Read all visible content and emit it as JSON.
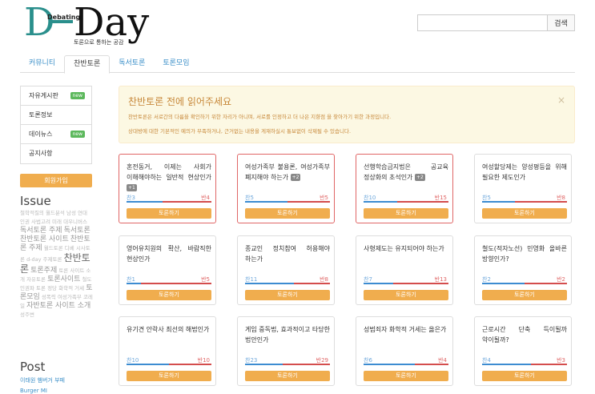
{
  "logo": {
    "big_d": "D",
    "word": "Day",
    "small": "Debating",
    "tagline": "토론으로 통하는 공감"
  },
  "search": {
    "value": "",
    "button_label": "검색"
  },
  "tabs": [
    {
      "label": "커뮤니티"
    },
    {
      "label": "찬반토론"
    },
    {
      "label": "독서토론"
    },
    {
      "label": "토론모임"
    }
  ],
  "sidebar": {
    "items": [
      {
        "label": "자유게시판",
        "badge": "new"
      },
      {
        "label": "토론정보",
        "badge": ""
      },
      {
        "label": "데이뉴스",
        "badge": "new"
      },
      {
        "label": "공지사항",
        "badge": ""
      }
    ],
    "join_label": "회원가입",
    "issue_title": "Issue",
    "tags": [
      {
        "text": "철학적질의",
        "size": "s"
      },
      {
        "text": "월드분석",
        "size": "s"
      },
      {
        "text": "남성",
        "size": "s"
      },
      {
        "text": "연대",
        "size": "s"
      },
      {
        "text": "인권",
        "size": "s"
      },
      {
        "text": "사법고려",
        "size": "s"
      },
      {
        "text": "미래",
        "size": "s"
      },
      {
        "text": "대우니버스",
        "size": "s"
      },
      {
        "text": "독서토론 주제",
        "size": "m"
      },
      {
        "text": "독서토론",
        "size": "m"
      },
      {
        "text": "찬반토론 사이트",
        "size": "m"
      },
      {
        "text": "찬반토론 주제",
        "size": "m"
      },
      {
        "text": "월드토론",
        "size": "s"
      },
      {
        "text": "디베",
        "size": "s"
      },
      {
        "text": "시사토론",
        "size": "s"
      },
      {
        "text": "d-day",
        "size": "s"
      },
      {
        "text": "주제토론",
        "size": "s"
      },
      {
        "text": "찬반토론",
        "size": "l"
      },
      {
        "text": "토론주제",
        "size": "m"
      },
      {
        "text": "토론",
        "size": "s"
      },
      {
        "text": "사이트",
        "size": "s"
      },
      {
        "text": "소개",
        "size": "s"
      },
      {
        "text": "자유토론",
        "size": "s"
      },
      {
        "text": "토론사이트",
        "size": "m"
      },
      {
        "text": "철도",
        "size": "s"
      },
      {
        "text": "인권파",
        "size": "s"
      },
      {
        "text": "토론",
        "size": "s"
      },
      {
        "text": "정당",
        "size": "s"
      },
      {
        "text": "화학적",
        "size": "s"
      },
      {
        "text": "거세",
        "size": "s"
      },
      {
        "text": "토론모임",
        "size": "m"
      },
      {
        "text": "성폭력",
        "size": "s"
      },
      {
        "text": "여성가족부",
        "size": "s"
      },
      {
        "text": "코레일",
        "size": "s"
      },
      {
        "text": "자반토론 사이트 소개",
        "size": "m"
      },
      {
        "text": "성주변",
        "size": "s"
      }
    ],
    "post_title": "Post",
    "posts": [
      {
        "text": "이태원 햄버거 부페"
      },
      {
        "text": "Burger MI"
      }
    ]
  },
  "alert": {
    "title": "찬반토론 전에 읽어주세요",
    "line1": "찬반토론은 서로간의 다름을 확인하기 위한 자리가 아니며, 서로를 인정하고 더 나은 지향점 을 찾아가기 위한 과정입니다.",
    "line2": "상대방에 대한 기본적인 예의가 부족하거나, 근거없는 내용을 게재하실시 통보없이 삭제될 수 있습니다.",
    "close": "×"
  },
  "cards": [
    {
      "q": "혼전동거, 이제는 사회가 이해해야하는 일반적 현상인가",
      "plus": "+1",
      "pro": 3,
      "con": 4,
      "hot": true,
      "pro_label": "찬3",
      "con_label": "반4",
      "btn": "토론하기"
    },
    {
      "q": "여성가족부 불용론, 여성가족부 폐지해야 하는가",
      "plus": "+2",
      "pro": 5,
      "con": 5,
      "hot": true,
      "pro_label": "찬5",
      "con_label": "반5",
      "btn": "토론하기"
    },
    {
      "q": "선행학습금지법은 공교육 정상화의 초석인가",
      "plus": "+2",
      "pro": 10,
      "con": 15,
      "hot": true,
      "pro_label": "찬10",
      "con_label": "반15",
      "btn": "토론하기"
    },
    {
      "q": "여성할당제는 양성평등을 위해 필요한 제도인가",
      "plus": "",
      "pro": 5,
      "con": 8,
      "hot": false,
      "pro_label": "찬5",
      "con_label": "반8",
      "btn": "토론하기"
    },
    {
      "q": "영어유치원의 확산, 바람직한 현상인가",
      "plus": "",
      "pro": 1,
      "con": 5,
      "hot": false,
      "pro_label": "찬1",
      "con_label": "반5",
      "btn": "토론하기"
    },
    {
      "q": "종교인 정치참여 허용해야 하는가",
      "plus": "",
      "pro": 11,
      "con": 8,
      "hot": false,
      "pro_label": "찬11",
      "con_label": "반8",
      "btn": "토론하기"
    },
    {
      "q": "사형제도는 유지되어야 하는가",
      "plus": "",
      "pro": 7,
      "con": 13,
      "hot": false,
      "pro_label": "찬7",
      "con_label": "반13",
      "btn": "토론하기"
    },
    {
      "q": "철도(적자노선) 민영화 올바른 방향인가?",
      "plus": "",
      "pro": 2,
      "con": 2,
      "hot": false,
      "pro_label": "찬2",
      "con_label": "반2",
      "btn": "토론하기"
    },
    {
      "q": "유기견 안락사 최선의 해법인가",
      "plus": "",
      "pro": 10,
      "con": 10,
      "hot": false,
      "pro_label": "찬10",
      "con_label": "반10",
      "btn": "토론하기"
    },
    {
      "q": "게임 중독법, 효과적이고 타당한 법안인가",
      "plus": "",
      "pro": 23,
      "con": 29,
      "hot": false,
      "pro_label": "찬23",
      "con_label": "반29",
      "btn": "토론하기"
    },
    {
      "q": "성범죄자 화학적 거세는 옳은가",
      "plus": "",
      "pro": 6,
      "con": 4,
      "hot": false,
      "pro_label": "찬6",
      "con_label": "반4",
      "btn": "토론하기"
    },
    {
      "q": "근로시간 단축 득이될까 약이될까?",
      "plus": "",
      "pro": 4,
      "con": 3,
      "hot": false,
      "pro_label": "찬4",
      "con_label": "반3",
      "btn": "토론하기"
    }
  ]
}
